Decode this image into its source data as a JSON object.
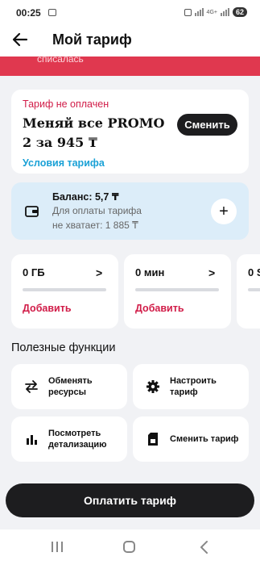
{
  "status_bar": {
    "time": "00:25",
    "battery": "62",
    "network": "4G+"
  },
  "header": {
    "title": "Мой тариф"
  },
  "banner": {
    "text": "списалась"
  },
  "tariff_card": {
    "status": "Тариф не оплачен",
    "name": "Меняй все PROMO 2 за 945 ₸",
    "change_button": "Сменить",
    "conditions_link": "Условия тарифа"
  },
  "balance": {
    "title": "Баланс: 5,7 ₸",
    "line1": "Для оплаты тарифа",
    "line2": "не хватает: 1 885 ₸"
  },
  "resources": [
    {
      "value": "0 ГБ",
      "add_label": "Добавить",
      "fill": 0
    },
    {
      "value": "0 мин",
      "add_label": "Добавить",
      "fill": 0
    },
    {
      "value": "0 S",
      "add_label": "",
      "fill": 0
    }
  ],
  "functions": {
    "title": "Полезные функции",
    "items": [
      {
        "label": "Обменять ресурсы",
        "icon": "exchange-arrows-icon"
      },
      {
        "label": "Настроить тариф",
        "icon": "gear-icon"
      },
      {
        "label": "Посмотреть детализацию",
        "icon": "bar-chart-icon"
      },
      {
        "label": "Сменить тариф",
        "icon": "sim-card-icon"
      }
    ]
  },
  "pay_button": {
    "label": "Оплатить тариф"
  },
  "colors": {
    "accent_red": "#d11c48",
    "link_blue": "#1aa1d6",
    "dark_button": "#1d1d1f",
    "balance_bg": "#dcedf9"
  }
}
